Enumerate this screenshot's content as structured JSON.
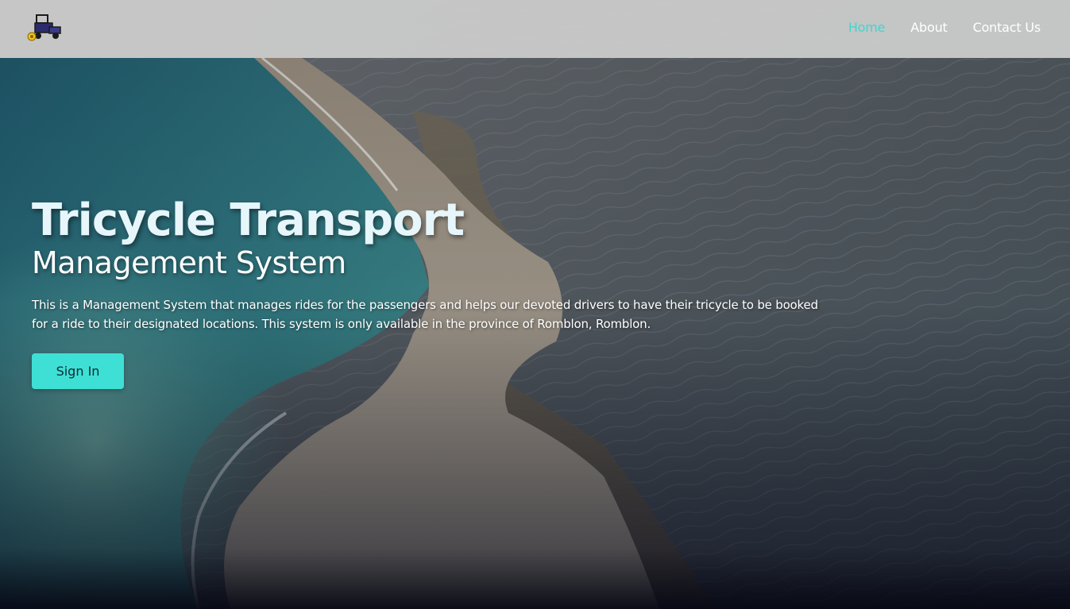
{
  "nav": {
    "links": [
      {
        "label": "Home",
        "active": true
      },
      {
        "label": "About",
        "active": false
      },
      {
        "label": "Contact Us",
        "active": false
      }
    ]
  },
  "hero": {
    "title": "Tricycle Transport",
    "subtitle": "Management System",
    "description": "This is a Management System that manages rides for the passengers and helps our devoted drivers to have their tricycle to be booked for a ride to their designated locations. This system is only available in the province of Romblon, Romblon.",
    "cta_label": "Sign In"
  },
  "background": {
    "description_icon": "aerial-beach-sandbar-photo"
  },
  "colors": {
    "accent": "#3ee0d5",
    "nav_active": "#3fd6cf",
    "navbar_bg": "#cdcdcd"
  }
}
